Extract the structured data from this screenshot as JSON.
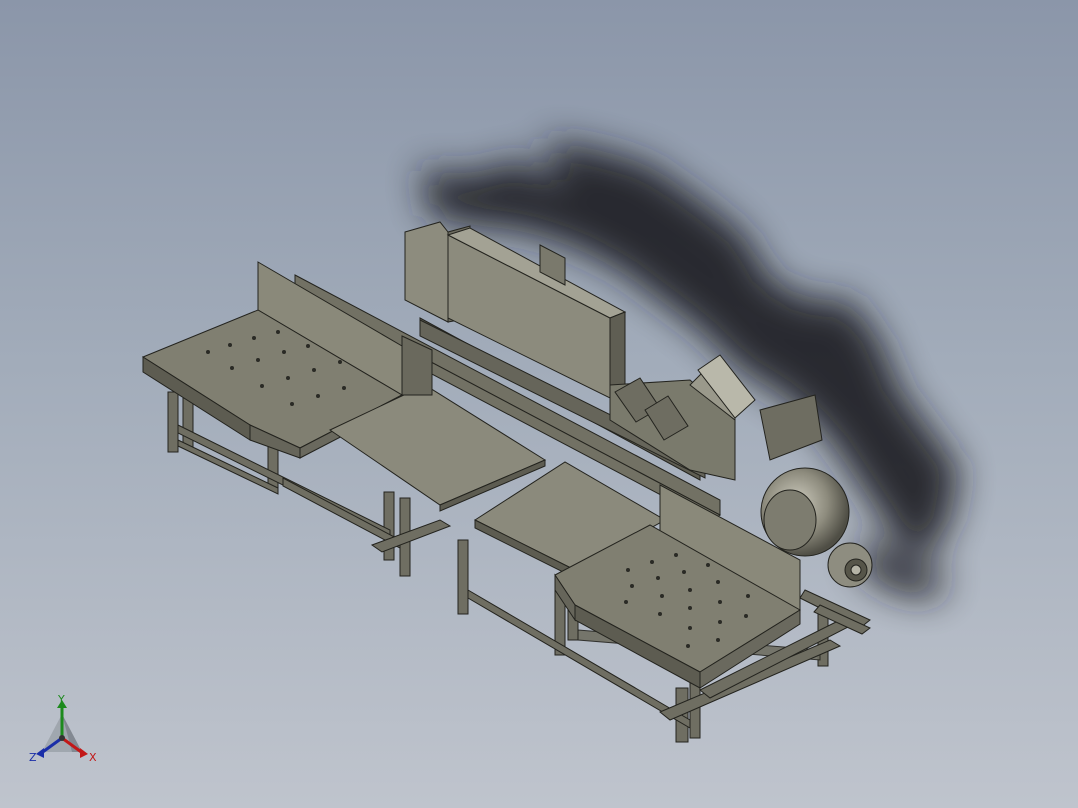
{
  "viewport": {
    "background_top": "#8b96a9",
    "background_bottom": "#bfc4cd"
  },
  "model": {
    "part_color": "#7e7d6e",
    "part_dark": "#4e4d43",
    "edge_color": "#23231e",
    "shadow_color": "#1c1d20"
  },
  "triad": {
    "icon": "coordinate-triad-icon",
    "x_label": "X",
    "y_label": "Y",
    "z_label": "Z",
    "x_color": "#c21818",
    "y_color": "#1d8a1d",
    "z_color": "#1a2ea8"
  }
}
